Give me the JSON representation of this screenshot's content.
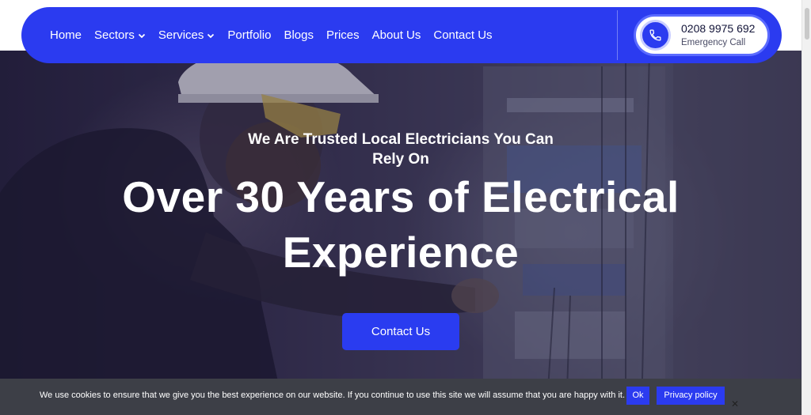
{
  "nav": {
    "items": [
      {
        "label": "Home",
        "has_dropdown": false
      },
      {
        "label": "Sectors",
        "has_dropdown": true
      },
      {
        "label": "Services",
        "has_dropdown": true
      },
      {
        "label": "Portfolio",
        "has_dropdown": false
      },
      {
        "label": "Blogs",
        "has_dropdown": false
      },
      {
        "label": "Prices",
        "has_dropdown": false
      },
      {
        "label": "About Us",
        "has_dropdown": false
      },
      {
        "label": "Contact Us",
        "has_dropdown": false
      }
    ],
    "phone_number": "0208 9975 692",
    "phone_label": "Emergency Call",
    "phone_icon": "phone-icon"
  },
  "hero": {
    "subtitle": "We Are Trusted Local Electricians You Can Rely On",
    "title": "Over 30 Years of Electrical Experience",
    "button_label": "Contact Us"
  },
  "cookie": {
    "text": "We use cookies to ensure that we give you the best experience on our website. If you continue to use this site we will assume that you are happy with it.",
    "ok_label": "Ok",
    "privacy_label": "Privacy policy",
    "close_label": "✕"
  },
  "colors": {
    "accent": "#2b3bf0",
    "cookie_bg": "#3d3f47",
    "hero_overlay": "#1e183c"
  }
}
